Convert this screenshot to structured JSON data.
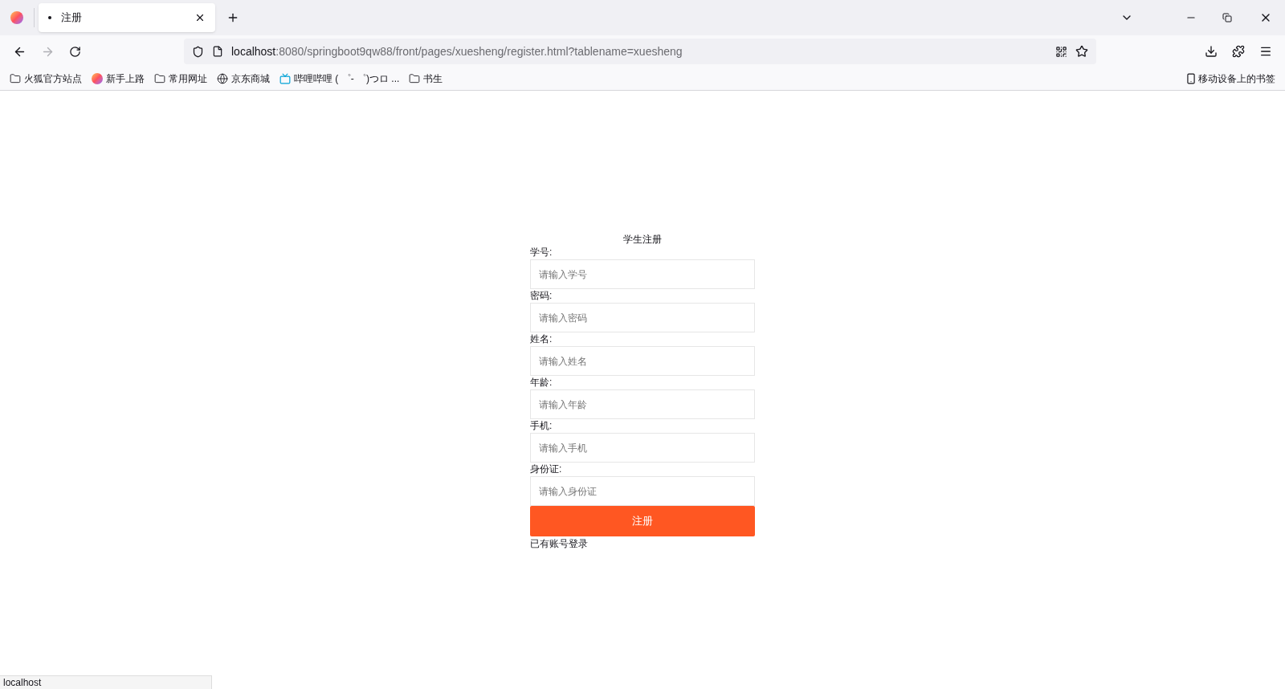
{
  "browser": {
    "tabs": [
      {
        "label": "注册",
        "selected": true
      }
    ],
    "url": {
      "host": "localhost",
      "rest": ":8080/springboot9qw88/front/pages/xuesheng/register.html?tablename=xuesheng"
    },
    "bookmarks": [
      {
        "kind": "folder",
        "label": "火狐官方站点"
      },
      {
        "kind": "firefox",
        "label": "新手上路"
      },
      {
        "kind": "folder",
        "label": "常用网址"
      },
      {
        "kind": "globe",
        "label": "京东商城"
      },
      {
        "kind": "tv",
        "label": "哔哩哔哩 ( ゜- ゜)つロ ..."
      },
      {
        "kind": "folder",
        "label": "书生"
      }
    ],
    "mobile_bookmarks": "移动设备上的书签"
  },
  "form": {
    "title": "学生注册",
    "fields": [
      {
        "label": "学号:",
        "placeholder": "请输入学号"
      },
      {
        "label": "密码:",
        "placeholder": "请输入密码"
      },
      {
        "label": "姓名:",
        "placeholder": "请输入姓名"
      },
      {
        "label": "年龄:",
        "placeholder": "请输入年龄"
      },
      {
        "label": "手机:",
        "placeholder": "请输入手机"
      },
      {
        "label": "身份证:",
        "placeholder": "请输入身份证"
      }
    ],
    "submit": "注册",
    "login_link": "已有账号登录"
  },
  "status_bar": "localhost"
}
